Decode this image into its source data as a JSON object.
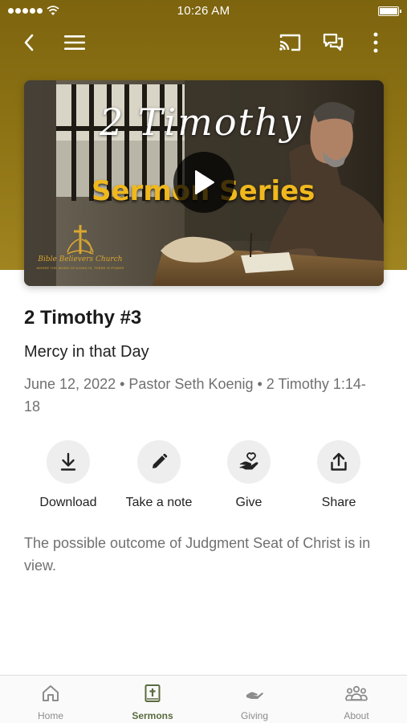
{
  "status_bar": {
    "time": "10:26 AM"
  },
  "top_bar": {
    "back_icon": "chevron-left-icon",
    "menu_icon": "hamburger-menu-icon",
    "cast_icon": "cast-icon",
    "chat_icon": "chat-bubbles-icon",
    "more_icon": "more-vertical-icon"
  },
  "video": {
    "title": "2 Timothy",
    "subtitle": "Sermon Series",
    "church_name": "Bible Believers Church",
    "church_tagline": "WHERE THE WORD OF A KING IS, THERE IS POWER",
    "play_icon": "play-icon"
  },
  "sermon": {
    "title": "2 Timothy #3",
    "subtitle": "Mercy in that Day",
    "meta": "June 12, 2022 • Pastor Seth Koenig • 2 Timothy 1:14-18",
    "description": "The possible outcome of Judgment Seat of Christ is in view."
  },
  "actions": [
    {
      "label": "Download",
      "icon": "download-icon"
    },
    {
      "label": "Take a note",
      "icon": "pencil-icon"
    },
    {
      "label": "Give",
      "icon": "hand-heart-icon"
    },
    {
      "label": "Share",
      "icon": "share-icon"
    }
  ],
  "bottom_nav": [
    {
      "label": "Home",
      "icon": "home-icon",
      "active": false
    },
    {
      "label": "Sermons",
      "icon": "bible-icon",
      "active": true
    },
    {
      "label": "Giving",
      "icon": "giving-hand-icon",
      "active": false
    },
    {
      "label": "About",
      "icon": "people-icon",
      "active": false
    }
  ],
  "colors": {
    "header_gold": "#8d7214",
    "accent_text_gold": "#f0b81e",
    "active_nav": "#5a6b3e",
    "muted_text": "#707070"
  }
}
